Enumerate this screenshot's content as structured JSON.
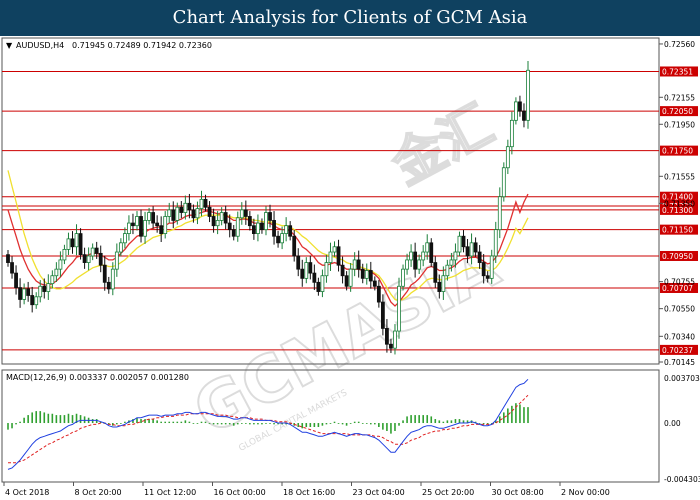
{
  "banner": {
    "title": "Chart Analysis for Clients of GCM Asia"
  },
  "chart_data": [
    {
      "type": "candlestick",
      "header": {
        "symbol_label": "AUDUSD,H4",
        "ohlc_text": "0.71945 0.72489 0.71942 0.72360"
      },
      "yaxis_ticks": [
        0.7256,
        0.7235,
        0.72155,
        0.7195,
        0.71555,
        0.7135,
        0.71155,
        0.7095,
        0.70755,
        0.7055,
        0.7034,
        0.70145
      ],
      "yaxis_tick_labels": [
        "0.72560",
        "0.72155",
        "0.71950",
        "0.71555",
        "0.71350",
        "0.70755",
        "0.70550",
        "0.70340",
        "0.70145"
      ],
      "ylim": [
        0.70145,
        0.7259
      ],
      "horizontal_levels": [
        {
          "value": 0.72351,
          "label": "0.72351"
        },
        {
          "value": 0.7205,
          "label": "0.72050"
        },
        {
          "value": 0.7175,
          "label": "0.71750"
        },
        {
          "value": 0.714,
          "label": "0.71400"
        },
        {
          "value": 0.7133,
          "label": "0.71330"
        },
        {
          "value": 0.713,
          "label": "0.71300"
        },
        {
          "value": 0.7115,
          "label": "0.71150"
        },
        {
          "value": 0.7095,
          "label": "0.70950"
        },
        {
          "value": 0.70707,
          "label": "0.70707"
        },
        {
          "value": 0.70237,
          "label": "0.70237"
        }
      ],
      "level_color": "#cc0000",
      "bull_color": "#1a7f3a",
      "bear_color": "#111111",
      "ma_fast_color": "#e03030",
      "ma_slow_color": "#f0e030",
      "x_tick_labels": [
        "4 Oct 2018",
        "8 Oct 20:00",
        "11 Oct 12:00",
        "16 Oct 00:00",
        "18 Oct 16:00",
        "23 Oct 04:00",
        "25 Oct 20:00",
        "30 Oct 08:00",
        "2 Nov 00:00"
      ],
      "closes": [
        0.709,
        0.7082,
        0.7071,
        0.7062,
        0.707,
        0.7065,
        0.7058,
        0.7064,
        0.7072,
        0.7068,
        0.7074,
        0.708,
        0.7085,
        0.7092,
        0.71,
        0.7108,
        0.7102,
        0.7112,
        0.7096,
        0.709,
        0.7095,
        0.7101,
        0.7097,
        0.7088,
        0.7075,
        0.707,
        0.7085,
        0.7098,
        0.7105,
        0.7112,
        0.712,
        0.7118,
        0.7125,
        0.711,
        0.7122,
        0.7128,
        0.712,
        0.7118,
        0.7112,
        0.7125,
        0.713,
        0.7122,
        0.7132,
        0.7128,
        0.7135,
        0.713,
        0.7124,
        0.7131,
        0.7138,
        0.7132,
        0.7125,
        0.7118,
        0.7122,
        0.7128,
        0.712,
        0.7115,
        0.711,
        0.7124,
        0.713,
        0.7125,
        0.7118,
        0.7112,
        0.712,
        0.7115,
        0.7128,
        0.7122,
        0.711,
        0.7105,
        0.7112,
        0.7118,
        0.711,
        0.7095,
        0.7085,
        0.7078,
        0.709,
        0.7082,
        0.7075,
        0.7068,
        0.708,
        0.709,
        0.7098,
        0.7102,
        0.7088,
        0.708,
        0.7072,
        0.7085,
        0.7092,
        0.7085,
        0.7078,
        0.7084,
        0.7076,
        0.7072,
        0.706,
        0.704,
        0.7028,
        0.7025,
        0.7038,
        0.7072,
        0.7085,
        0.7092,
        0.7098,
        0.7085,
        0.7092,
        0.7098,
        0.7105,
        0.709,
        0.7075,
        0.7068,
        0.708,
        0.7088,
        0.7092,
        0.7098,
        0.711,
        0.7102,
        0.7095,
        0.7105,
        0.7098,
        0.709,
        0.708,
        0.7078,
        0.7095,
        0.7115,
        0.714,
        0.7162,
        0.7178,
        0.7198,
        0.7212,
        0.7205,
        0.7198,
        0.7236
      ],
      "ma_fast": [
        0.713,
        0.712,
        0.711,
        0.71,
        0.7092,
        0.7085,
        0.708,
        0.7076,
        0.7074,
        0.7073,
        0.7073,
        0.7074,
        0.7076,
        0.7079,
        0.7083,
        0.7087,
        0.709,
        0.7094,
        0.7095,
        0.7095,
        0.7096,
        0.7097,
        0.7097,
        0.7096,
        0.7094,
        0.7092,
        0.7092,
        0.7094,
        0.7097,
        0.71,
        0.7104,
        0.7107,
        0.711,
        0.7111,
        0.7113,
        0.7115,
        0.7116,
        0.7117,
        0.7117,
        0.7118,
        0.712,
        0.712,
        0.7122,
        0.7123,
        0.7125,
        0.7126,
        0.7126,
        0.7127,
        0.7128,
        0.7129,
        0.7129,
        0.7128,
        0.7127,
        0.7127,
        0.7126,
        0.7124,
        0.7122,
        0.7122,
        0.7123,
        0.7123,
        0.7122,
        0.712,
        0.712,
        0.7119,
        0.712,
        0.712,
        0.7118,
        0.7116,
        0.7115,
        0.7115,
        0.7114,
        0.7111,
        0.7107,
        0.7102,
        0.71,
        0.7097,
        0.7094,
        0.709,
        0.7088,
        0.7088,
        0.7089,
        0.709,
        0.7089,
        0.7087,
        0.7085,
        0.7085,
        0.7085,
        0.7085,
        0.7084,
        0.7084,
        0.7083,
        0.7081,
        0.7078,
        0.7072,
        0.7066,
        0.706,
        0.7057,
        0.706,
        0.7064,
        0.7068,
        0.7073,
        0.7075,
        0.7078,
        0.7082,
        0.7086,
        0.7087,
        0.7086,
        0.7084,
        0.7084,
        0.7085,
        0.7086,
        0.7088,
        0.7091,
        0.7093,
        0.7093,
        0.7094,
        0.7094,
        0.7093,
        0.7091,
        0.7089,
        0.709,
        0.7094,
        0.71,
        0.7108,
        0.7116,
        0.7126,
        0.7136,
        0.7128,
        0.7136,
        0.7142
      ],
      "ma_slow": [
        0.716,
        0.7148,
        0.7136,
        0.7124,
        0.7112,
        0.7102,
        0.7093,
        0.7086,
        0.708,
        0.7076,
        0.7073,
        0.7071,
        0.707,
        0.707,
        0.7071,
        0.7073,
        0.7075,
        0.7078,
        0.708,
        0.7082,
        0.7084,
        0.7086,
        0.7087,
        0.7088,
        0.7088,
        0.7087,
        0.7087,
        0.7088,
        0.709,
        0.7092,
        0.7095,
        0.7098,
        0.7101,
        0.7103,
        0.7105,
        0.7107,
        0.7109,
        0.711,
        0.7111,
        0.7113,
        0.7114,
        0.7115,
        0.7117,
        0.7118,
        0.712,
        0.7121,
        0.7122,
        0.7123,
        0.7125,
        0.7126,
        0.7126,
        0.7126,
        0.7126,
        0.7126,
        0.7126,
        0.7125,
        0.7124,
        0.7124,
        0.7124,
        0.7124,
        0.7123,
        0.7122,
        0.7122,
        0.7121,
        0.7121,
        0.7121,
        0.712,
        0.7119,
        0.7118,
        0.7118,
        0.7117,
        0.7115,
        0.7113,
        0.711,
        0.7108,
        0.7105,
        0.7102,
        0.7099,
        0.7097,
        0.7096,
        0.7095,
        0.7094,
        0.7093,
        0.7092,
        0.709,
        0.7089,
        0.7088,
        0.7087,
        0.7086,
        0.7085,
        0.7084,
        0.7082,
        0.708,
        0.7076,
        0.7071,
        0.7066,
        0.7062,
        0.7061,
        0.7062,
        0.7064,
        0.7067,
        0.7069,
        0.7071,
        0.7074,
        0.7077,
        0.7078,
        0.7078,
        0.7077,
        0.7077,
        0.7078,
        0.7079,
        0.708,
        0.7082,
        0.7084,
        0.7085,
        0.7086,
        0.7086,
        0.7086,
        0.7085,
        0.7084,
        0.7084,
        0.7086,
        0.709,
        0.7095,
        0.7101,
        0.7108,
        0.7116,
        0.7112,
        0.7118,
        0.7124
      ]
    },
    {
      "type": "bar_line",
      "header": {
        "label": "MACD(12,26,9) 0.003337 0.002057 0.001280"
      },
      "yaxis_tick_labels": [
        "0.003703",
        "0.00",
        "-0.004303"
      ],
      "ylim": [
        -0.004303,
        0.003703
      ],
      "macd_color": "#2040e0",
      "signal_color": "#e02020",
      "hist_color": "#30a030",
      "macd": [
        -0.0035,
        -0.0034,
        -0.0031,
        -0.0028,
        -0.0024,
        -0.002,
        -0.0016,
        -0.0013,
        -0.0011,
        -0.001,
        -0.0009,
        -0.0008,
        -0.0007,
        -0.0006,
        -0.0004,
        -0.0002,
        -0.0001,
        0.0001,
        0.0002,
        0.0002,
        0.0002,
        0.0002,
        0.0002,
        0.0001,
        0.0,
        -0.0002,
        -0.0003,
        -0.0003,
        -0.0002,
        -0.0001,
        0.0001,
        0.0002,
        0.0004,
        0.0004,
        0.0005,
        0.0006,
        0.0006,
        0.0006,
        0.0005,
        0.0006,
        0.0006,
        0.0006,
        0.0007,
        0.0007,
        0.0008,
        0.0008,
        0.0007,
        0.0007,
        0.0008,
        0.0008,
        0.0007,
        0.0006,
        0.0005,
        0.0005,
        0.0005,
        0.0004,
        0.0003,
        0.0003,
        0.0004,
        0.0004,
        0.0003,
        0.0002,
        0.0002,
        0.0002,
        0.0002,
        0.0002,
        0.0001,
        0.0,
        0.0,
        0.0,
        -0.0001,
        -0.0003,
        -0.0005,
        -0.0007,
        -0.0007,
        -0.0008,
        -0.0009,
        -0.001,
        -0.001,
        -0.0009,
        -0.0008,
        -0.0007,
        -0.0008,
        -0.0009,
        -0.001,
        -0.0009,
        -0.0008,
        -0.0008,
        -0.0009,
        -0.0009,
        -0.001,
        -0.0011,
        -0.0013,
        -0.0016,
        -0.0019,
        -0.0022,
        -0.0022,
        -0.0018,
        -0.0014,
        -0.001,
        -0.0007,
        -0.0006,
        -0.0005,
        -0.0003,
        -0.0002,
        -0.0002,
        -0.0003,
        -0.0004,
        -0.0004,
        -0.0003,
        -0.0002,
        -0.0001,
        0.0,
        0.0,
        0.0,
        0.0001,
        0.0,
        -0.0001,
        -0.0002,
        -0.0002,
        -0.0001,
        0.0002,
        0.0007,
        0.0012,
        0.0017,
        0.0022,
        0.0027,
        0.0029,
        0.003,
        0.0033
      ],
      "signal": [
        -0.003,
        -0.003,
        -0.003,
        -0.0029,
        -0.0028,
        -0.0026,
        -0.0024,
        -0.0022,
        -0.002,
        -0.0018,
        -0.0016,
        -0.0015,
        -0.0013,
        -0.0012,
        -0.001,
        -0.0009,
        -0.0007,
        -0.0006,
        -0.0004,
        -0.0003,
        -0.0002,
        -0.0001,
        -0.0001,
        0.0,
        0.0,
        -0.0001,
        -0.0001,
        -0.0002,
        -0.0002,
        -0.0002,
        -0.0001,
        -0.0001,
        0.0,
        0.0001,
        0.0002,
        0.0003,
        0.0003,
        0.0004,
        0.0004,
        0.0005,
        0.0005,
        0.0005,
        0.0006,
        0.0006,
        0.0006,
        0.0007,
        0.0007,
        0.0007,
        0.0007,
        0.0007,
        0.0007,
        0.0007,
        0.0006,
        0.0006,
        0.0006,
        0.0005,
        0.0005,
        0.0004,
        0.0004,
        0.0004,
        0.0004,
        0.0003,
        0.0003,
        0.0003,
        0.0002,
        0.0002,
        0.0002,
        0.0001,
        0.0001,
        0.0001,
        0.0,
        -0.0001,
        -0.0002,
        -0.0003,
        -0.0004,
        -0.0005,
        -0.0006,
        -0.0007,
        -0.0008,
        -0.0008,
        -0.0008,
        -0.0008,
        -0.0008,
        -0.0008,
        -0.0008,
        -0.0009,
        -0.0009,
        -0.0009,
        -0.0009,
        -0.0009,
        -0.0009,
        -0.001,
        -0.001,
        -0.0011,
        -0.0013,
        -0.0014,
        -0.0016,
        -0.0016,
        -0.0016,
        -0.0015,
        -0.0013,
        -0.0012,
        -0.0011,
        -0.0009,
        -0.0008,
        -0.0007,
        -0.0006,
        -0.0006,
        -0.0005,
        -0.0005,
        -0.0004,
        -0.0004,
        -0.0003,
        -0.0002,
        -0.0002,
        -0.0001,
        -0.0001,
        -0.0001,
        -0.0001,
        -0.0001,
        -0.0001,
        0.0,
        0.0002,
        0.0004,
        0.0006,
        0.0009,
        0.0012,
        0.0015,
        0.0018,
        0.0021
      ]
    }
  ],
  "watermark": {
    "brand": "GCMASIA",
    "chinese": "金汇",
    "tagline": "GLOBAL CAPITAL MARKETS"
  }
}
